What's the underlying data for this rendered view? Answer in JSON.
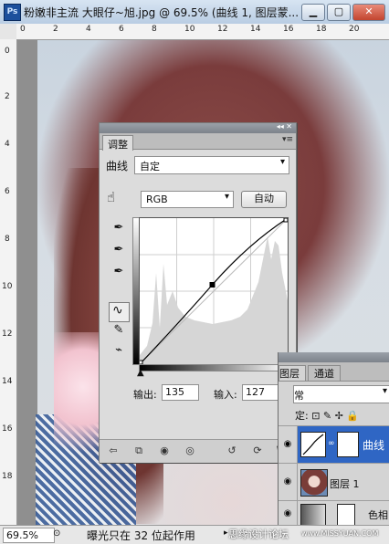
{
  "window": {
    "title": "粉嫩非主流  大眼仔~旭.jpg @ 69.5% (曲线 1, 图层蒙...",
    "app_icon": "Ps",
    "minimize_glyph": "▁",
    "maximize_glyph": "▢",
    "close_glyph": "✕"
  },
  "rulers": {
    "top": [
      "0",
      "2",
      "4",
      "6",
      "8",
      "10",
      "12",
      "14",
      "16",
      "18",
      "20"
    ],
    "left": [
      "0",
      "2",
      "4",
      "6",
      "8",
      "10",
      "12",
      "14",
      "16",
      "18"
    ]
  },
  "adjustments": {
    "top_glyphs": "◂◂ ✕",
    "tab_label": "调整",
    "menu_glyph": "▾≡",
    "curve_label": "曲线",
    "preset_value": "自定",
    "channel_value": "RGB",
    "auto_label": "自动",
    "output_label": "输出:",
    "output_value": "135",
    "input_label": "输入:",
    "input_value": "127",
    "dropdown_glyph": "▾",
    "hand_glyph": "☝",
    "eyedropper_black": "✒",
    "eyedropper_gray": "✒",
    "eyedropper_white": "✒",
    "curve_tool_glyph": "∿",
    "pencil_glyph": "✎",
    "smooth_glyph": "⌁",
    "bottom_buttons": [
      "⇦",
      "⧉",
      "◉",
      "◎",
      "↺",
      "⟳",
      "🗑"
    ],
    "curve_point": {
      "input": 127,
      "output": 135
    },
    "icons": [
      "target-adjust-icon",
      "black-eyedropper-icon",
      "gray-eyedropper-icon",
      "white-eyedropper-icon",
      "curve-edit-icon",
      "pencil-icon",
      "smooth-icon"
    ]
  },
  "layers": {
    "tab_layers": "图层",
    "tab_channels": "通道",
    "blend_mode": "常",
    "lock_label": "定:",
    "lock_glyphs": "⊡ ✎ ✢ 🔒",
    "eye_glyph": "◉",
    "chain_glyph": "∞",
    "rows": [
      {
        "name": "曲线",
        "selected": true
      },
      {
        "name": "图层 1",
        "selected": false
      },
      {
        "name": "色相",
        "selected": false
      }
    ]
  },
  "status": {
    "zoom": "69.5%",
    "icon_glyph": "⊙",
    "message": "曝光只在 32 位起作用",
    "arrow_glyph": "▸",
    "watermark": "思缘设计论坛",
    "watermark_url": "www.MISSYUAN.COM"
  },
  "colors": {
    "selection_blue": "#2f66c4",
    "panel_gray": "#dcdcdc"
  }
}
